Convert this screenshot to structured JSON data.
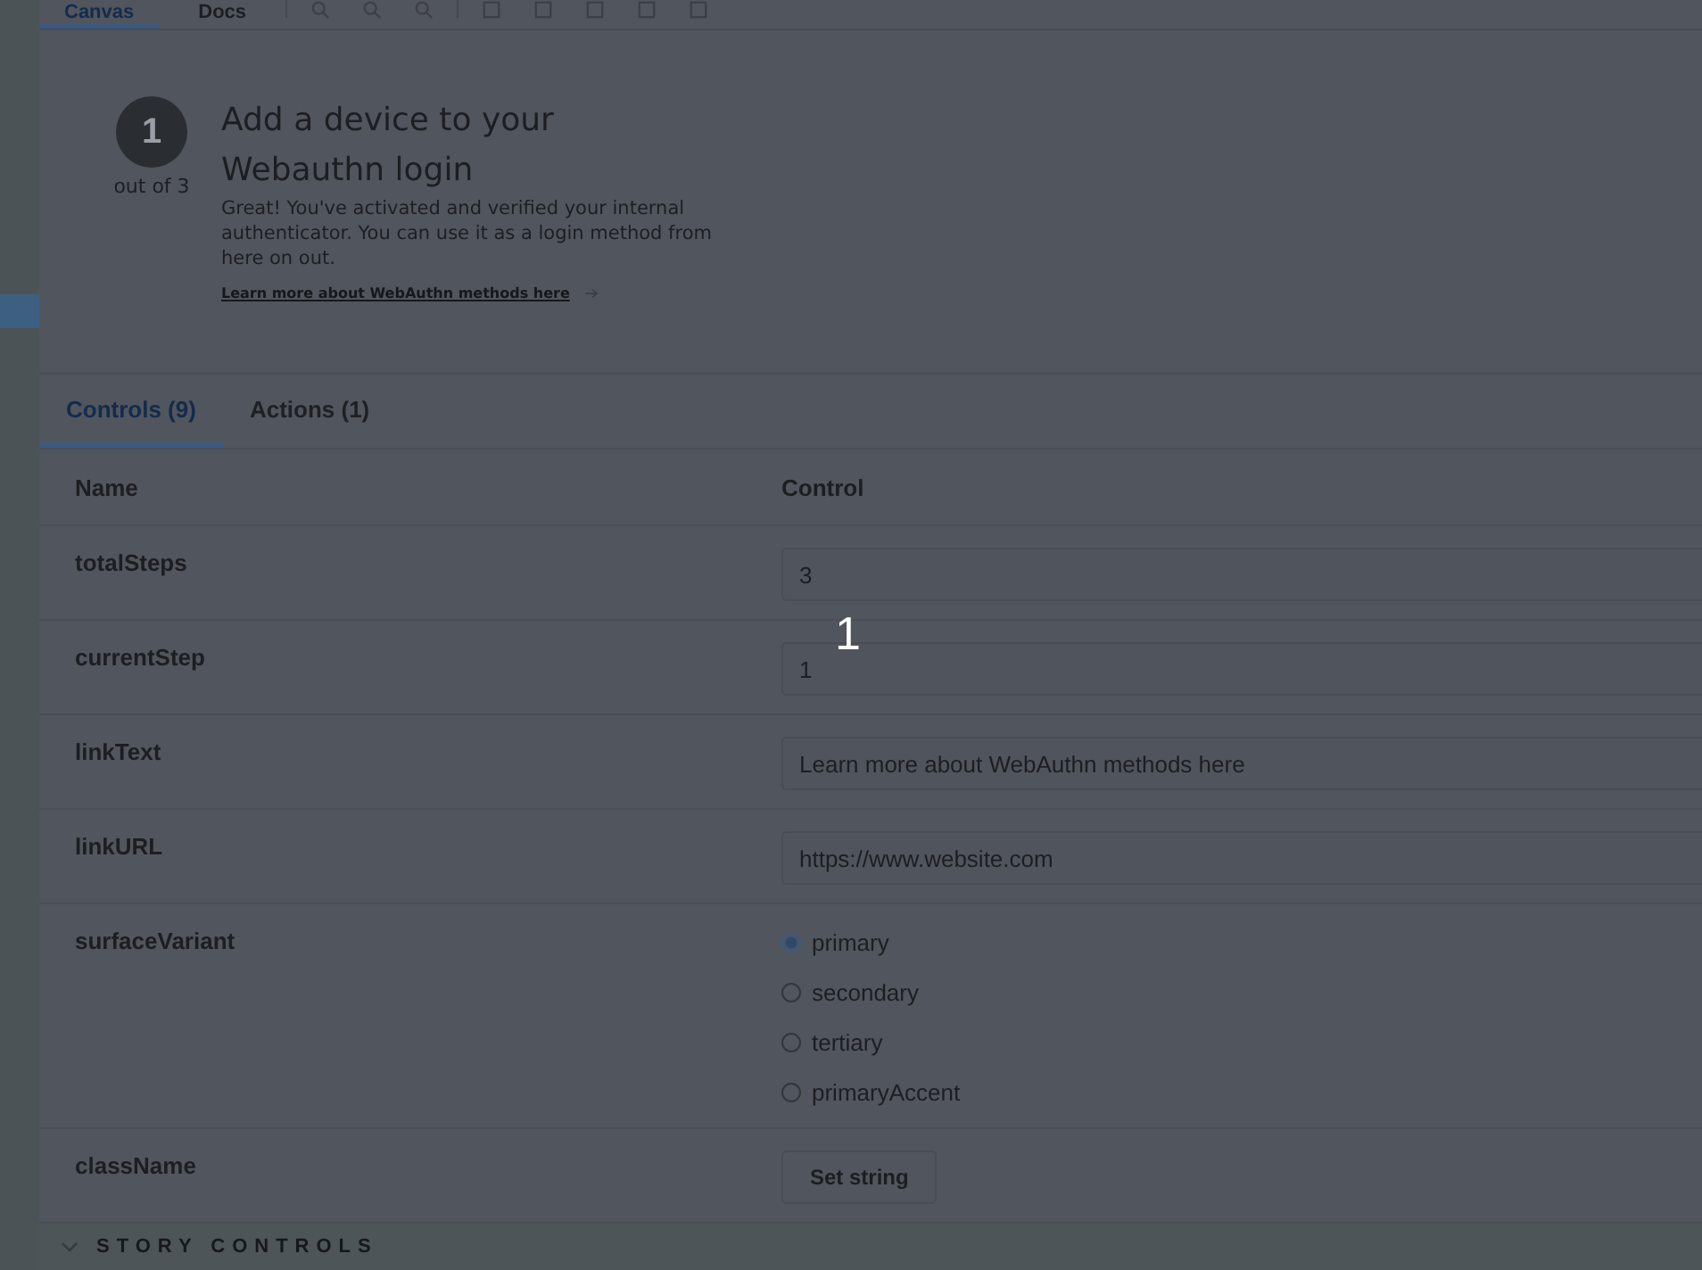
{
  "toolbar": {
    "tabs": [
      {
        "label": "Canvas",
        "selected": true
      },
      {
        "label": "Docs",
        "selected": false
      }
    ]
  },
  "preview": {
    "step": {
      "current": "1",
      "caption": "out of 3"
    },
    "title": "Add a device to your Webauthn login",
    "body": "Great! You've activated and verified your internal authenticator. You can use it as a login method from here on out.",
    "link": "Learn more about WebAuthn methods here"
  },
  "addon_panel": {
    "tabs": [
      {
        "label": "Controls (9)",
        "selected": true
      },
      {
        "label": "Actions (1)",
        "selected": false
      }
    ],
    "columns": [
      "Name",
      "Control"
    ],
    "rows": [
      {
        "name": "totalSteps",
        "kind": "text",
        "value": "3"
      },
      {
        "name": "currentStep",
        "kind": "text",
        "value": "1"
      },
      {
        "name": "linkText",
        "kind": "text",
        "value": "Learn more about WebAuthn methods here"
      },
      {
        "name": "linkURL",
        "kind": "text",
        "value": "https://www.website.com"
      },
      {
        "name": "surfaceVariant",
        "kind": "radio",
        "options": [
          {
            "label": "primary",
            "selected": true
          },
          {
            "label": "secondary",
            "selected": false
          },
          {
            "label": "tertiary",
            "selected": false
          },
          {
            "label": "primaryAccent",
            "selected": false
          }
        ]
      },
      {
        "name": "className",
        "kind": "button",
        "button": "Set string"
      }
    ]
  },
  "section_toggle": {
    "label": "STORY CONTROLS"
  },
  "overlay_marker": "1"
}
